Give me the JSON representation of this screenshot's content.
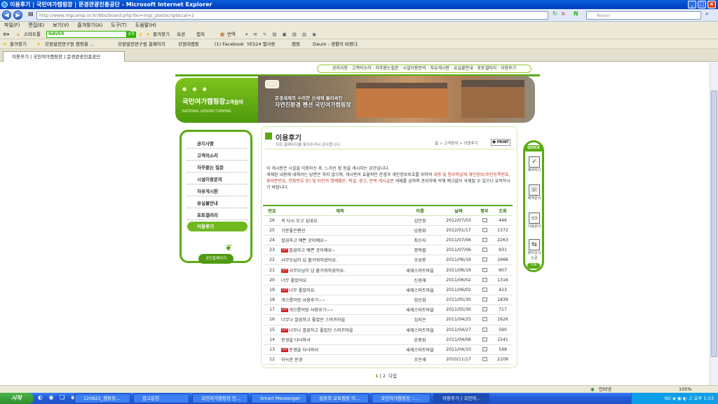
{
  "window": {
    "title": "이용후기 | 국민여가캠핑장 | 문경관광진흥공단 - Microsoft Internet Explorer"
  },
  "address": {
    "url": "http://www.mgcamp.or.kr/bbs/board.php?bo=mgt_postscript&cal=2",
    "search_placeholder": "Naver"
  },
  "menu": [
    "파일(F)",
    "편집(E)",
    "보기(V)",
    "즐겨찾기(A)",
    "도구(T)",
    "도움말(H)"
  ],
  "toolbar": {
    "smart": "스마트툴",
    "naver": "NAVER",
    "search_btn": "검색",
    "items": [
      "즐겨찾기",
      "옥션",
      "캡처",
      "번역"
    ]
  },
  "favorites": {
    "label": "즐겨찾기",
    "items": [
      "강원발전연구원 캠핑을 ...",
      "강원발전연구원 홈페이지",
      "강원대캠핑",
      "(1) Facebook",
      "YES24 별사랑",
      "캠핑",
      "Daum - 생활이 바뀐다"
    ]
  },
  "tab": {
    "title": "이용후기 | 국민여가캠핑장 | 문경관광진흥공단"
  },
  "site": {
    "topnav": [
      "공지사항",
      "고객의소리",
      "자주묻는질문",
      "시설이용문의",
      "자유게시판",
      "유실물안내",
      "포토갤러리",
      "이용후기"
    ],
    "logo_title": "국민여가캠핑장",
    "logo_suffix": "고객참여",
    "logo_sub": "NATIONAL LEISURE CAMPING",
    "banner_line1": "문경새재의 수려한 산세에 둘러싸인",
    "banner_line2": "자연친환경 펜션 국민여가캠핑장",
    "leftnav": [
      "공지사항",
      "고객의소리",
      "자주묻는 질문",
      "시설이용문의",
      "자유게시판",
      "유실물안내",
      "포토갤러리",
      "이용후기"
    ],
    "leftnav_footer": "공단홈페이지",
    "page_title": "이용후기",
    "page_sub": "저희 홈페이지를 찾아주셔서 감사합니다.",
    "breadcrumb": "홈 > 고객참여 > 이용후기",
    "print": "PRINT",
    "notice_line1": "이 게시판은 시설을 이용하신 후, 느끼신 점 등을 게시하는 공간입니다.",
    "notice_line2": "게재된 내용에 대해서는 답변은 하지 않으며, 게시판의 효율적인 운영과 개인정보보호를 위하여",
    "notice_red1": "내용 및 첨부파일에 개인정보(주민등록번호, 휴대폰번호, 전화번호 등) 및 타인의 명예훼손, 욕설, 광고, 반복 게시글",
    "notice_line3": "은 게재를 금하며 관리자에 의해 예고없이 삭제될 수 있으니 유의하시기 바랍니다.",
    "table_headers": [
      "번호",
      "제목",
      "이름",
      "날짜",
      "평부",
      "조회"
    ],
    "rows": [
      {
        "no": "26",
        "title": "꼭 다시 오고 싶네요.",
        "reply": false,
        "name": "김민정",
        "date": "2012/07/03",
        "views": "446"
      },
      {
        "no": "25",
        "title": "기분좋은펜션",
        "reply": false,
        "name": "남용희",
        "date": "2012/01/17",
        "views": "1372"
      },
      {
        "no": "24",
        "title": "깔끔하고 예쁜 곳이예요~",
        "reply": false,
        "name": "최수지",
        "date": "2011/07/06",
        "views": "2263"
      },
      {
        "no": "23",
        "title": "깔끔하고 예쁜 곳이예요~",
        "reply": true,
        "name": "영혁렬",
        "date": "2011/07/06",
        "views": "931"
      },
      {
        "no": "22",
        "title": "사무모님이 넘 즐거워하셨어요.",
        "reply": false,
        "name": "조성용",
        "date": "2011/06/16",
        "views": "1666"
      },
      {
        "no": "21",
        "title": "사무모님이 넘 즐거워하셨어요.",
        "reply": true,
        "name": "새재스마트마을",
        "date": "2011/06/16",
        "views": "607"
      },
      {
        "no": "20",
        "title": "너무 좋았어요.",
        "reply": false,
        "name": "신경재",
        "date": "2011/06/02",
        "views": "1316"
      },
      {
        "no": "19",
        "title": "너무 좋았어요.",
        "reply": true,
        "name": "새재스마트마을",
        "date": "2011/06/02",
        "views": "423"
      },
      {
        "no": "18",
        "title": "게으름이방 사용후기~~",
        "reply": false,
        "name": "엄선희",
        "date": "2011/05/30",
        "views": "1839"
      },
      {
        "no": "17",
        "title": "게으름이방 사용후기~~",
        "reply": true,
        "name": "새재스마트마을",
        "date": "2011/05/30",
        "views": "717"
      },
      {
        "no": "16",
        "title": "너무나 깔끔하고 좋았던 스머프마을",
        "reply": false,
        "name": "심지은",
        "date": "2011/04/25",
        "views": "1626"
      },
      {
        "no": "15",
        "title": "너무나 깔끔하고 좋았던 스머프마을",
        "reply": true,
        "name": "새재스마트마을",
        "date": "2011/04/27",
        "views": "590"
      },
      {
        "no": "14",
        "title": "문경을 다녀와서",
        "reply": false,
        "name": "윤중화",
        "date": "2011/04/06",
        "views": "1541"
      },
      {
        "no": "13",
        "title": "문경을 다녀와서",
        "reply": true,
        "name": "새재스마트마을",
        "date": "2011/04/10",
        "views": "548"
      },
      {
        "no": "12",
        "title": "아늑한 문경",
        "reply": false,
        "name": "조은래",
        "date": "2010/11/17",
        "views": "2109"
      }
    ],
    "reply_badge": "답변",
    "pager": {
      "p1": "1",
      "p2": "2",
      "next": "다음"
    },
    "quick": {
      "title": "QUICK",
      "items": [
        "예약하기",
        "예약문의",
        "이용문의",
        "찾아오시는길"
      ],
      "top": "TOP"
    }
  },
  "status": {
    "zone": "인터넷",
    "zoom": "105%"
  },
  "taskbar": {
    "start": "시작",
    "tasks": [
      "120822_캠핑장...",
      "참고문헌",
      "국민여가캠핑장 안...",
      "Smart Messenger",
      "섬휴의 오토캠핑 이...",
      "국민여가캠핑장 ::...",
      "이용후기 | 국민여..."
    ],
    "clock": "오후 1:53",
    "lang": "KO"
  }
}
